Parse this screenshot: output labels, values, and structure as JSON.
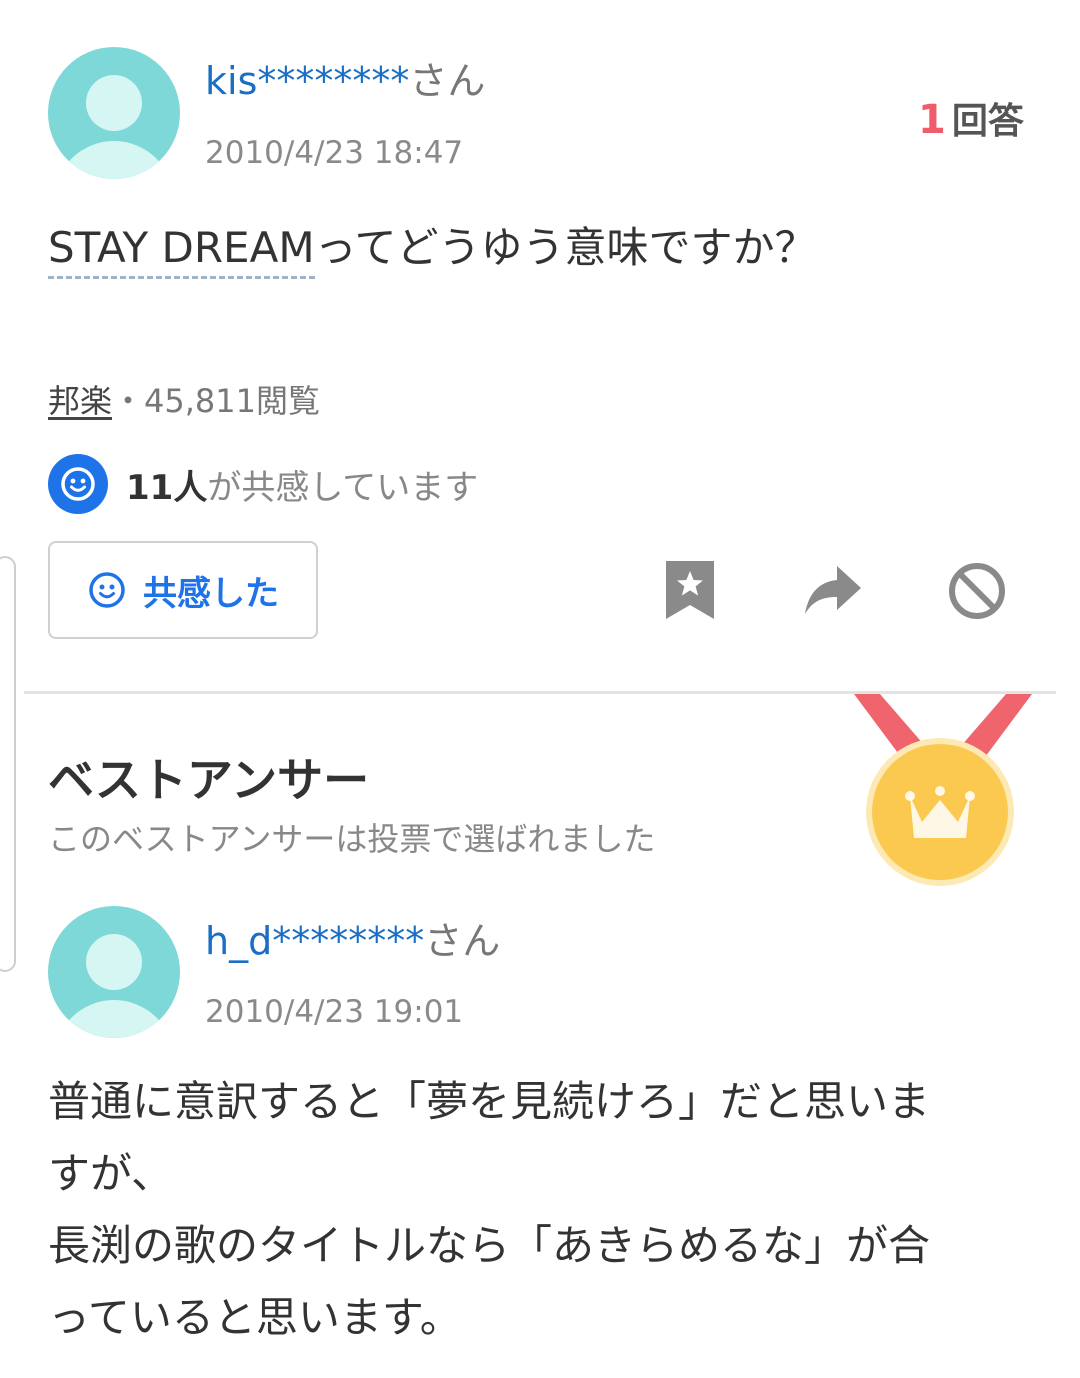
{
  "question": {
    "user_id": "kis********",
    "user_suffix": "さん",
    "date": "2010/4/23 18:47",
    "answer_count": "1",
    "answer_label": "回答",
    "title_keyword": "STAY DREAM",
    "title_rest": "ってどうゆう意味ですか？",
    "category": "邦楽",
    "separator": "・",
    "views": "45,811閲覧",
    "empathy_count": "11人",
    "empathy_text": "が共感しています",
    "empathy_button_label": "共感した",
    "icons": [
      "smile-icon",
      "bookmark-star-icon",
      "share-arrow-icon",
      "block-icon"
    ],
    "colors": {
      "link_blue": "#1a6fc4",
      "accent_blue": "#1e73e8",
      "answer_count_pink": "#ef5d6c"
    }
  },
  "best_answer": {
    "heading": "ベストアンサー",
    "subheading": "このベストアンサーは投票で選ばれました",
    "medal_icon": "crown-medal-icon",
    "user_id": "h_d********",
    "user_suffix": "さん",
    "date": "2010/4/23 19:01",
    "lines": [
      "普通に意訳すると「夢を見続けろ」だと思いま",
      "すが、",
      "長渕の歌のタイトルなら「あきらめるな」が合",
      "っていると思います。"
    ]
  }
}
